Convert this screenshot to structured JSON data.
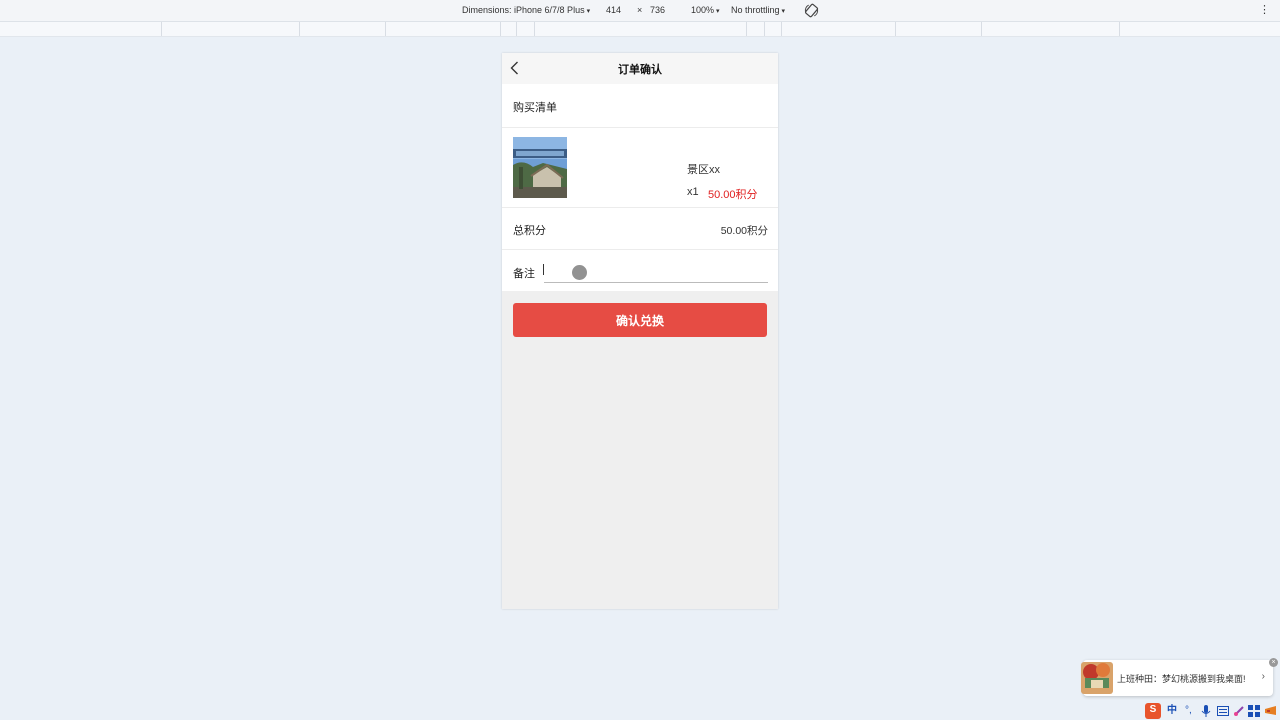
{
  "devtools": {
    "dimensions_label": "Dimensions: iPhone 6/7/8 Plus",
    "width": "414",
    "times": "×",
    "height": "736",
    "zoom": "100%",
    "throttling": "No throttling",
    "caret": "▾",
    "more": "⋮"
  },
  "page": {
    "back_icon": "chevron-left-icon",
    "title": "订单确认",
    "list_label": "购买清单",
    "item": {
      "name": "景区xx",
      "qty": "x1",
      "price": "50.00积分"
    },
    "total_label": "总积分",
    "total_value": "50.00积分",
    "remark_label": "备注",
    "remark_value": "",
    "confirm_label": "确认兑换"
  },
  "notification": {
    "text": "上班种田：梦幻桃源搬到我桌面!",
    "arrow": "›",
    "close": "×"
  },
  "tray": {
    "ime_brand": "S",
    "ime_lang": "中",
    "punct": "°,"
  },
  "colors": {
    "accent_red": "#e64c44",
    "price_red": "#e02020",
    "page_bg": "#eaf0f7"
  }
}
